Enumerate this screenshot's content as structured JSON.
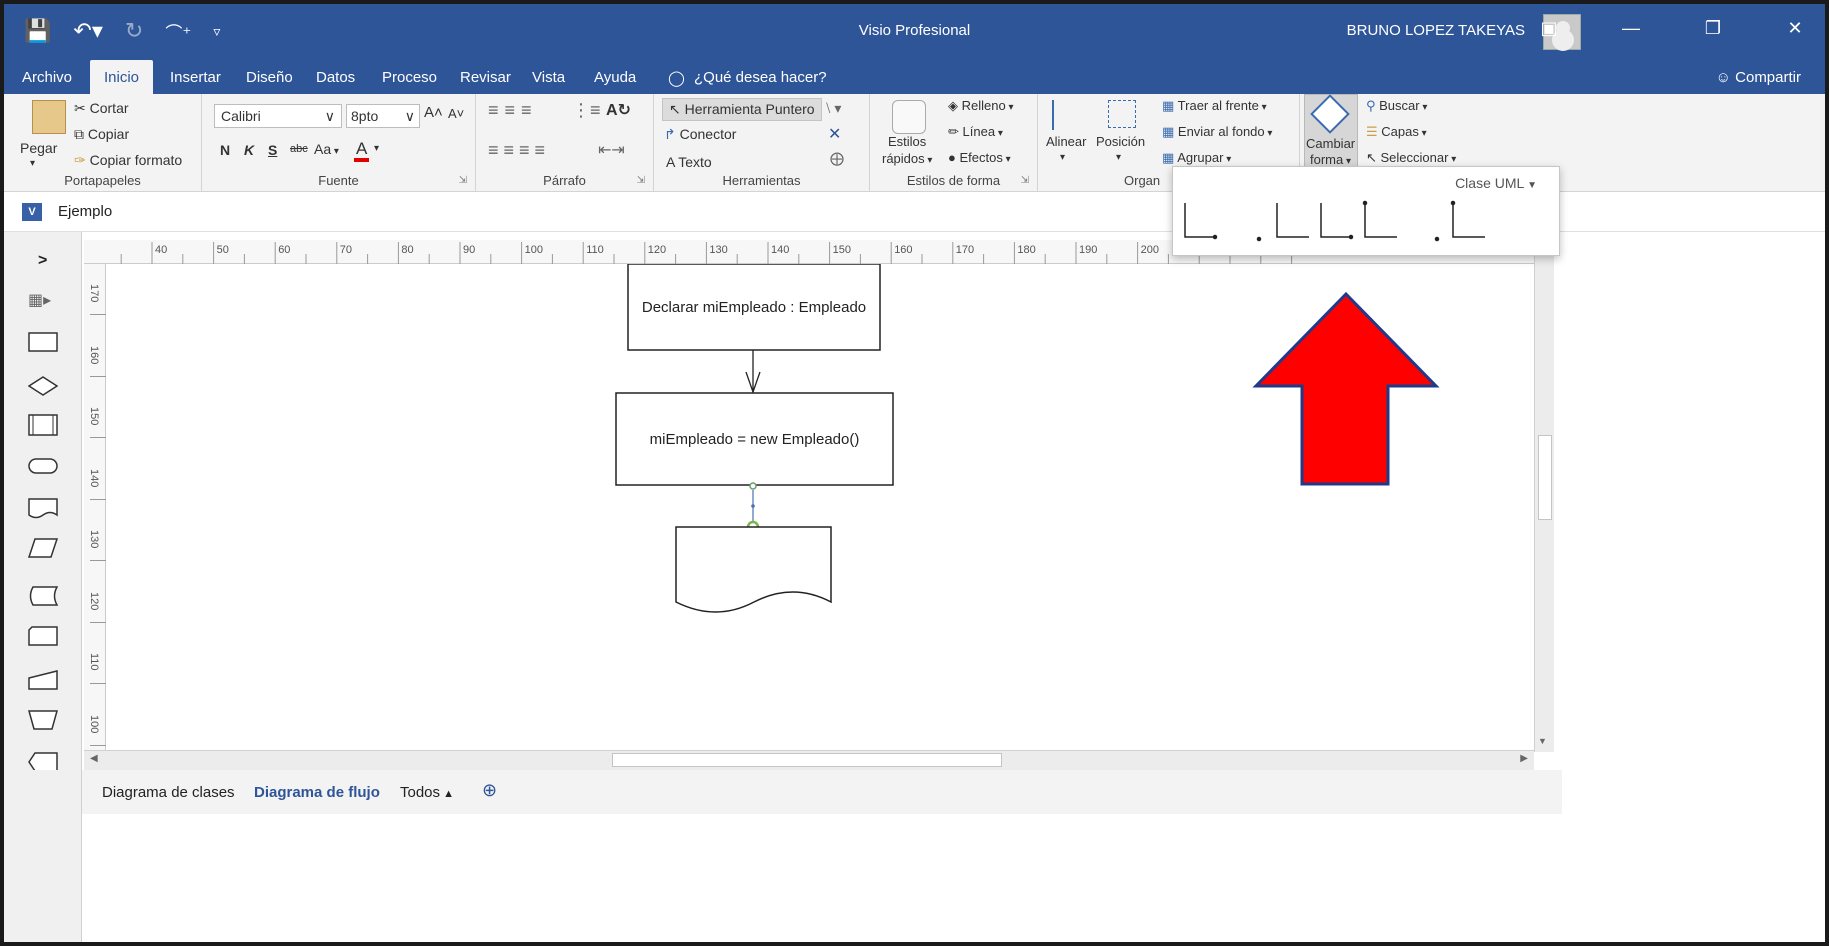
{
  "window": {
    "title": "Visio Profesional",
    "user": "BRUNO LOPEZ TAKEYAS"
  },
  "tabs": {
    "items": [
      "Archivo",
      "Inicio",
      "Insertar",
      "Diseño",
      "Datos",
      "Proceso",
      "Revisar",
      "Vista",
      "Ayuda"
    ],
    "active": "Inicio",
    "search_placeholder": "¿Qué desea hacer?",
    "share": "Compartir"
  },
  "ribbon": {
    "portapapeles": {
      "label": "Portapapeles",
      "paste": "Pegar",
      "cut": "Cortar",
      "copy": "Copiar",
      "format_painter": "Copiar formato"
    },
    "fuente": {
      "label": "Fuente",
      "font_name": "Calibri",
      "font_size": "8pto",
      "bold": "N",
      "italic": "K",
      "underline": "S",
      "strike": "abc",
      "case": "Aa",
      "font_color_letter": "A"
    },
    "parrafo": {
      "label": "Párrafo"
    },
    "herramientas": {
      "label": "Herramientas",
      "pointer": "Herramienta Puntero",
      "connector": "Conector",
      "text": "Texto"
    },
    "estilos_forma": {
      "label": "Estilos de forma",
      "quick_styles": "Estilos",
      "quick_styles_2": "rápidos",
      "fill": "Relleno",
      "line": "Línea",
      "effects": "Efectos"
    },
    "organizar": {
      "label": "Organ",
      "align": "Alinear",
      "position": "Posición",
      "bring_front": "Traer al frente",
      "send_back": "Enviar al fondo",
      "group": "Agrupar"
    },
    "edicion": {
      "change_shape": "Cambiar",
      "change_shape_2": "forma",
      "find": "Buscar",
      "layers": "Capas",
      "select": "Seleccionar"
    }
  },
  "document": {
    "name": "Ejemplo"
  },
  "ruler": {
    "h_ticks": [
      "40",
      "50",
      "60",
      "70",
      "80",
      "90",
      "100",
      "110",
      "120",
      "130",
      "140",
      "150",
      "160",
      "170",
      "180",
      "190",
      "200"
    ],
    "v_ticks": [
      "170",
      "160",
      "150",
      "140",
      "130",
      "120",
      "110",
      "100"
    ]
  },
  "diagram": {
    "box1": "Declarar miEmpleado : Empleado",
    "box2": "miEmpleado = new Empleado()"
  },
  "popup": {
    "title": "Clase UML"
  },
  "pages": {
    "items": [
      "Diagrama de clases",
      "Diagrama de flujo",
      "Todos"
    ],
    "active": "Diagrama de flujo"
  },
  "colors": {
    "accent": "#2e5597",
    "arrow_fill": "#ff0000",
    "arrow_stroke": "#1f3a8a"
  }
}
